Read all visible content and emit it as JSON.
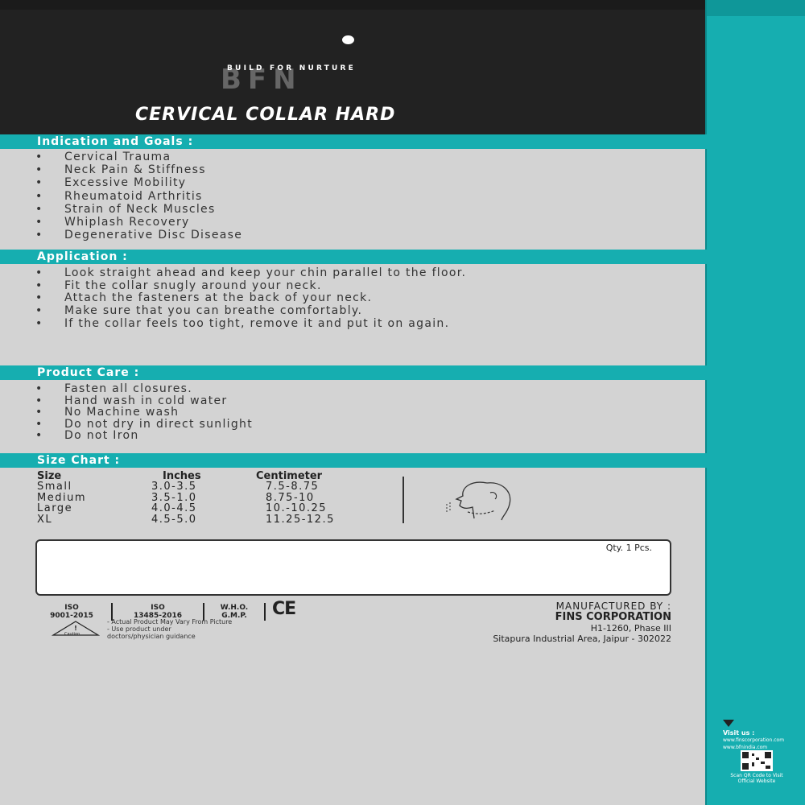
{
  "brand": {
    "tagline": "BUILD FOR NURTURE",
    "logo_text": "BFN"
  },
  "product_title": "CERVICAL COLLAR HARD",
  "indications": {
    "heading": "Indication and Goals :",
    "items": [
      "Cervical Trauma",
      "Neck Pain & Stiffness",
      "Excessive Mobility",
      "Rheumatoid Arthritis",
      "Strain of Neck Muscles",
      "Whiplash Recovery",
      "Degenerative Disc Disease"
    ]
  },
  "application": {
    "heading": "Application :",
    "items": [
      "Look straight ahead and keep your chin parallel to the floor.",
      "Fit the collar snugly around your neck.",
      "Attach the fasteners at the back of your neck.",
      "Make sure that you can breathe comfortably.",
      "If the collar feels too tight, remove it and put it  on again."
    ]
  },
  "care": {
    "heading": "Product Care :",
    "items": [
      "Fasten all closures.",
      "Hand wash in cold water",
      "No Machine wash",
      "Do not dry in direct sunlight",
      "Do not Iron"
    ]
  },
  "size_chart": {
    "heading": "Size Chart :",
    "columns": [
      "Size",
      "Inches",
      "Centimeter"
    ],
    "sizes": "Small\nMedium\nLarge\nXL",
    "inches": "3.0-3.5\n3.5-1.0\n4.0-4.5\n4.5-5.0",
    "cm": "7.5-8.75\n8.75-10\n10.-10.25\n11.25-12.5"
  },
  "qty_label": "Qty. 1 Pcs.",
  "certifications": [
    {
      "line1": "ISO",
      "line2": "9001-2015"
    },
    {
      "line1": "ISO",
      "line2": "13485-2016"
    },
    {
      "line1": "W.H.O.",
      "line2": "G.M.P."
    }
  ],
  "ce_mark": "CE",
  "caution_label": "Caution",
  "notes": [
    "- Actual Product May Vary From Picture",
    "- Use product under",
    "doctors/physician guidance"
  ],
  "manufacturer": {
    "label": "MANUFACTURED BY :",
    "name": "FINS CORPORATION",
    "address1": "H1-1260, Phase III",
    "address2": "Sitapura Industrial Area, Jaipur - 302022"
  },
  "side_panel": {
    "visit_label": "Visit us :",
    "site1": "www.finscorporation.com",
    "site2": "www.bfnindia.com",
    "qr_note": "Scan QR Code to Visit Official Website"
  },
  "colors": {
    "teal": "#16aeb0",
    "dark": "#222222",
    "panel": "#d3d3d3"
  }
}
